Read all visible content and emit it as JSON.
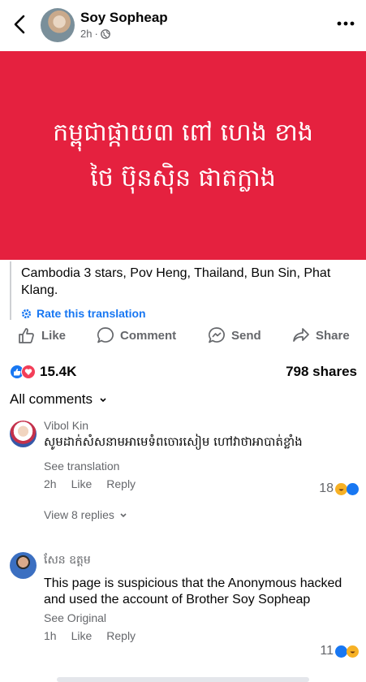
{
  "post": {
    "author": "Soy Sopheap",
    "time": "2h",
    "banner_lines": [
      "កម្ពុជាផ្កាយ៣ ពៅ ហេង ខាង",
      "ថៃ ប៊ុនសុិន ផាតក្លាង"
    ],
    "translation": "Cambodia 3 stars, Pov Heng, Thailand, Bun Sin, Phat Klang.",
    "rate_label": "Rate this translation"
  },
  "actions": {
    "like": "Like",
    "comment": "Comment",
    "send": "Send",
    "share": "Share"
  },
  "stats": {
    "reactions": "15.4K",
    "shares": "798 shares"
  },
  "comments_sort": "All comments",
  "comments": [
    {
      "name": "Vibol Kin",
      "text": "សូមដាក់សំសនាមអាមេទំពចោរសៀម ហៅវាថាអាបាត់ខ្លាំង",
      "link": "See translation",
      "time": "2h",
      "like": "Like",
      "reply": "Reply",
      "count": "18",
      "replies": "View 8 replies"
    },
    {
      "name": "សែន ឧត្តម",
      "text": "This page is suspicious that the Anonymous hacked and used the account of Brother Soy Sopheap",
      "link": "See Original",
      "time": "1h",
      "like": "Like",
      "reply": "Reply",
      "count": "11"
    }
  ],
  "colors": {
    "banner": "#e5213f",
    "link_blue": "#1877f2",
    "muted": "#65676b"
  }
}
